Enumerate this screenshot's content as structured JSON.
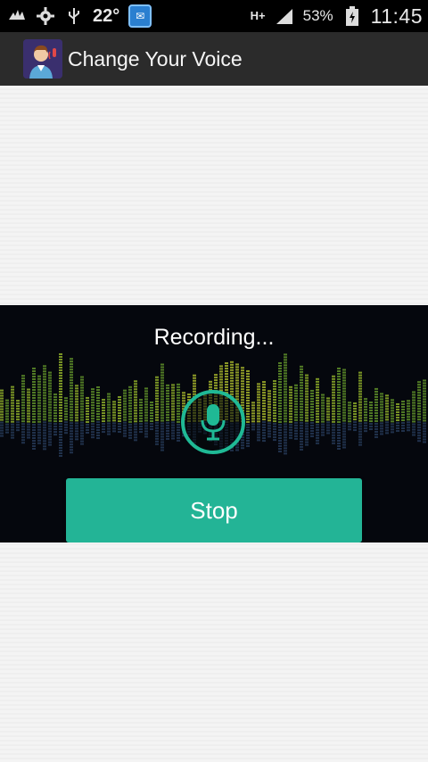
{
  "status_bar": {
    "temperature": "22°",
    "network": "H+",
    "battery_percent": "53%",
    "time": "11:45",
    "icons": [
      "gesture-icon",
      "settings-gear-icon",
      "usb-icon",
      "mail-icon",
      "data-transfer-icon",
      "signal-icon",
      "battery-charging-icon"
    ]
  },
  "action_bar": {
    "title": "Change Your Voice",
    "icon": "app-logo-icon"
  },
  "recording": {
    "status_text": "Recording...",
    "mic_icon": "microphone-icon",
    "stop_label": "Stop"
  },
  "colors": {
    "accent": "#23b496",
    "panel_bg": "#05070d",
    "action_bar_bg": "#2b2b2b"
  }
}
